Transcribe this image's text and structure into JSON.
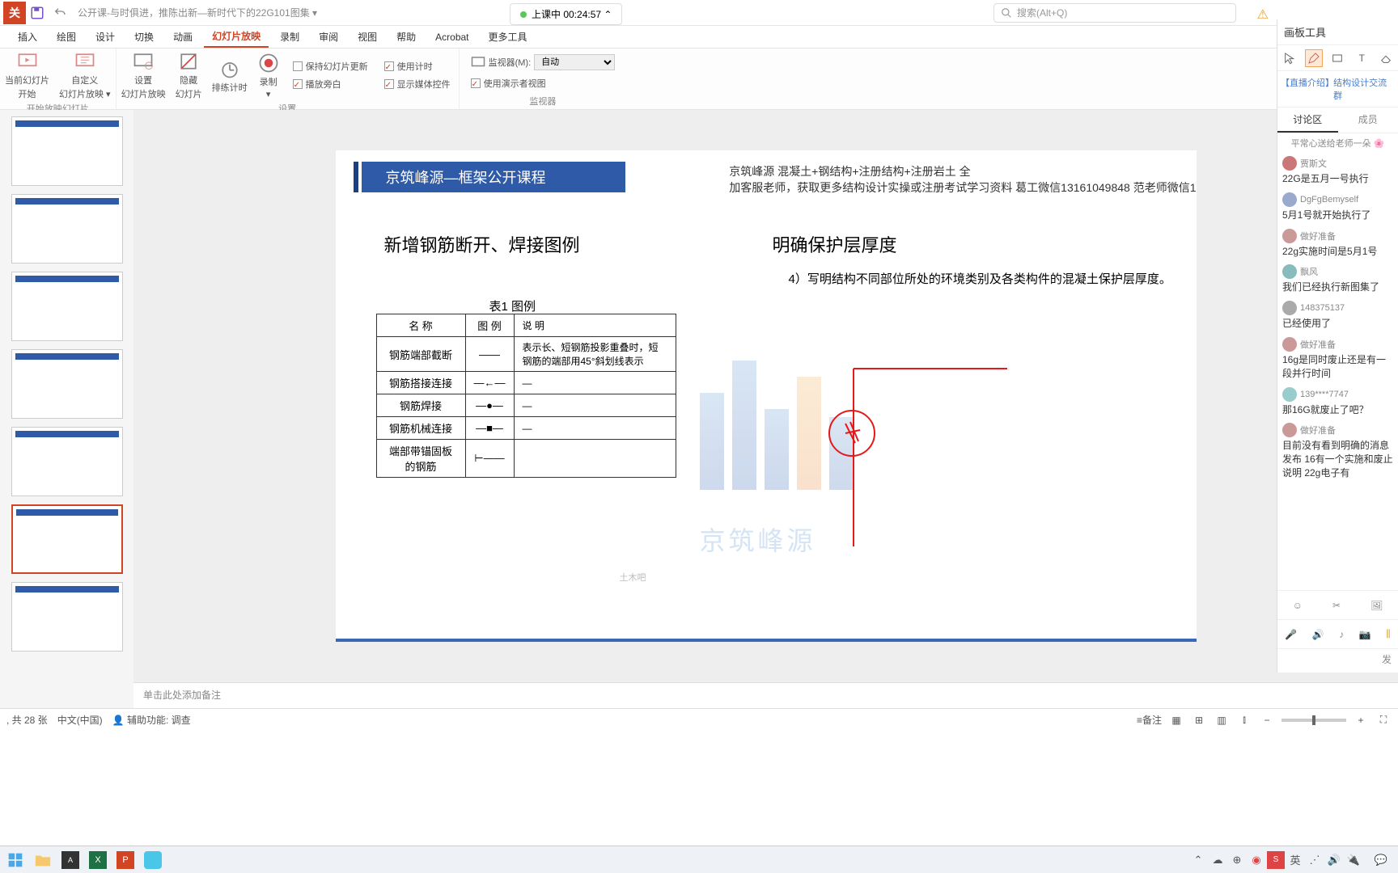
{
  "title_bar": {
    "doc_title": "公开课-与时俱进，推陈出新—新时代下的22G101图集 ▾",
    "search_placeholder": "搜索(Alt+Q)",
    "live_label": "上课中 00:24:57 ⌃"
  },
  "menu": [
    "插入",
    "绘图",
    "设计",
    "切换",
    "动画",
    "幻灯片放映",
    "录制",
    "审阅",
    "视图",
    "帮助",
    "Acrobat",
    "更多工具"
  ],
  "menu_active_index": 5,
  "ribbon": {
    "g1": [
      {
        "label1": "当前幻灯片",
        "label2": "开始"
      },
      {
        "label1": "自定义",
        "label2": "幻灯片放映 ▾"
      }
    ],
    "g1_caption": "开始放映幻灯片",
    "g2": [
      {
        "label1": "设置",
        "label2": "幻灯片放映"
      },
      {
        "label1": "隐藏",
        "label2": "幻灯片"
      },
      {
        "label1": "排练计时",
        "label2": ""
      },
      {
        "label1": "录制",
        "label2": "▾"
      }
    ],
    "g2_checks": [
      {
        "label": "保持幻灯片更新",
        "on": false
      },
      {
        "label": "播放旁白",
        "on": true
      },
      {
        "label": "使用计时",
        "on": true
      },
      {
        "label": "显示媒体控件",
        "on": true
      }
    ],
    "g2_caption": "设置",
    "g3_label": "监视器(M):",
    "g3_value": "自动",
    "g3_check": {
      "label": "使用演示者视图",
      "on": true
    },
    "g3_caption": "监视器"
  },
  "slide": {
    "title": "京筑峰源—框架公开课程",
    "meta1": "京筑峰源 混凝土+钢结构+注册结构+注册岩土 全",
    "meta2": "加客服老师，获取更多结构设计实操或注册考试学习资料 葛工微信13161049848 范老师微信1",
    "sub1": "新增钢筋断开、焊接图例",
    "sub2": "明确保护层厚度",
    "para": "4）写明结构不同部位所处的环境类别及各类构件的混凝土保护层厚度。",
    "table_title": "表1  图例",
    "table_h": [
      "名 称",
      "图 例",
      "说 明"
    ],
    "table_rows": [
      [
        "钢筋端部截断",
        "——",
        "表示长、短钢筋投影重叠时，短钢筋的端部用45°斜划线表示"
      ],
      [
        "钢筋搭接连接",
        "—←—",
        "—"
      ],
      [
        "钢筋焊接",
        "—●—",
        "—"
      ],
      [
        "钢筋机械连接",
        "—■—",
        "—"
      ],
      [
        "端部带锚固板的钢筋",
        "⊢——",
        ""
      ]
    ],
    "watermark": "京筑峰源",
    "watermark2": "土木吧"
  },
  "notes_placeholder": "单击此处添加备注",
  "status": {
    "slide_count": ", 共 28 张",
    "lang": "中文(中国)",
    "access": "辅助功能: 调查",
    "notes_btn": "≡备注"
  },
  "side": {
    "title": "画板工具",
    "link1": "【直播介绍】",
    "link2": "结构设计交流群",
    "tab1": "讨论区",
    "tab2": "成员",
    "banner": "平常心送给老师一朵",
    "messages": [
      {
        "u": "贾斯文",
        "t": "22G是五月一号执行"
      },
      {
        "u": "DgFgBemyself",
        "t": "5月1号就开始执行了"
      },
      {
        "u": "做好准备",
        "t": "22g实施时间是5月1号"
      },
      {
        "u": "飘风",
        "t": "我们已经执行新图集了"
      },
      {
        "u": "148375137",
        "t": "已经使用了"
      },
      {
        "u": "做好准备",
        "t": "16g是同时废止还是有一段并行时间"
      },
      {
        "u": "139****7747",
        "t": "那16G就废止了吧？"
      },
      {
        "u": "做好准备",
        "t": "目前没有看到明确的消息发布 16有一个实施和废止说明 22g电子有"
      }
    ],
    "send": "发"
  },
  "tray_time": "",
  "icons": {
    "search": "search-icon",
    "save": "save-icon"
  }
}
